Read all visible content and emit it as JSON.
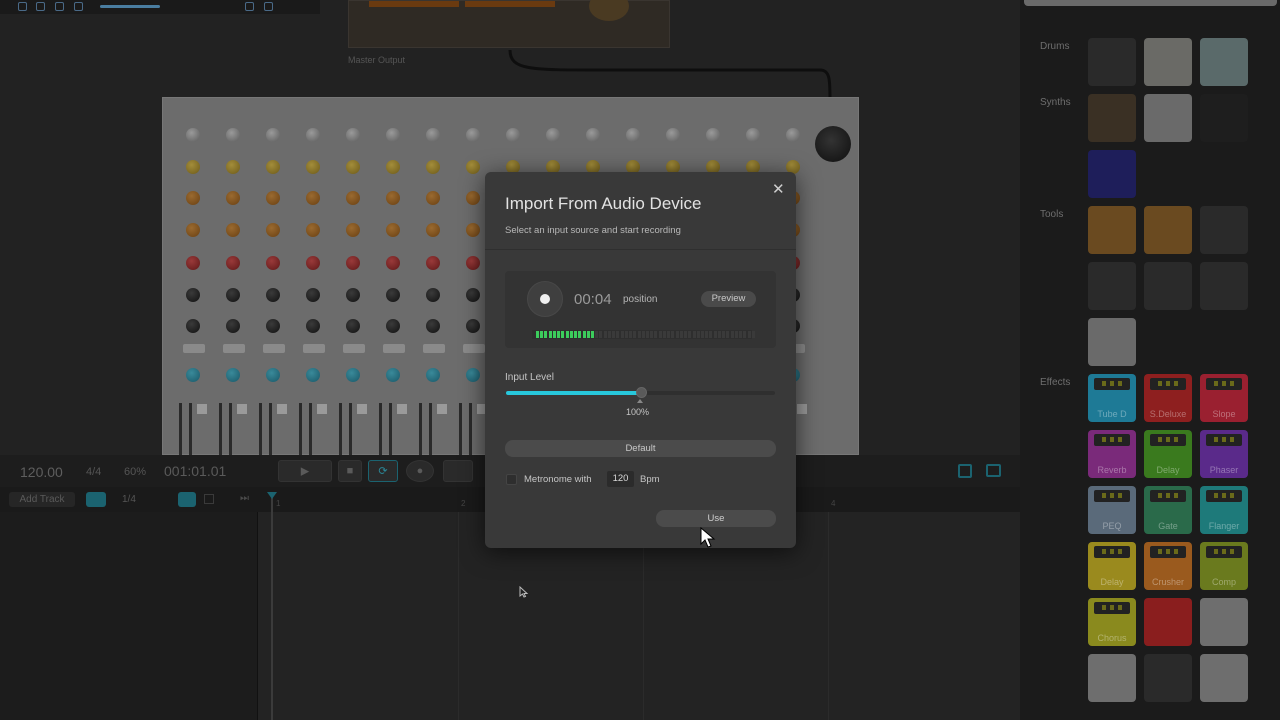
{
  "transport": {
    "tempo": "120.00",
    "signature": "4/4",
    "zoom": "60%",
    "position": "001:01.01"
  },
  "tracks": {
    "add_track_label": "Add Track",
    "quantize": "1/4",
    "ruler_marks": [
      "1",
      "2",
      "3",
      "4"
    ]
  },
  "master_output_label": "Master Output",
  "browser": {
    "categories": [
      {
        "label": "Drums"
      },
      {
        "label": "Synths"
      },
      {
        "label": "Tools"
      },
      {
        "label": "Effects"
      }
    ],
    "effects": [
      {
        "label": "Tube D",
        "color": "#1e7a96"
      },
      {
        "label": "S.Deluxe",
        "color": "#8e1f1f"
      },
      {
        "label": "Slope",
        "color": "#9a2030"
      },
      {
        "label": "Reverb",
        "color": "#7a2a7a"
      },
      {
        "label": "Delay",
        "color": "#3a7a1e"
      },
      {
        "label": "Phaser",
        "color": "#5a2a8a"
      },
      {
        "label": "PEQ",
        "color": "#5a6a7a"
      },
      {
        "label": "Gate",
        "color": "#2a6a4a"
      },
      {
        "label": "Flanger",
        "color": "#1e7a7a"
      },
      {
        "label": "Delay",
        "color": "#9a8a1e"
      },
      {
        "label": "Crusher",
        "color": "#9a5a1e"
      },
      {
        "label": "Comp",
        "color": "#6a7a1e"
      },
      {
        "label": "Chorus",
        "color": "#8a8a1e"
      }
    ]
  },
  "dialog": {
    "title": "Import From Audio Device",
    "subtitle": "Select an input source and start recording",
    "close_icon": "close-icon",
    "record": {
      "time": "00:04",
      "position_label": "position",
      "preview_label": "Preview",
      "meter_segments_total": 52,
      "meter_segments_lit": 14
    },
    "input_level": {
      "label": "Input Level",
      "value": 0.5,
      "display": "100%"
    },
    "source_select": "Default",
    "metronome": {
      "label": "Metronome with",
      "checked": false,
      "bpm": "120",
      "bpm_label": "Bpm"
    },
    "use_label": "Use"
  },
  "colors": {
    "accent": "#28c8dc",
    "meter_on": "#3ccc5c",
    "dialog_bg": "#393939"
  }
}
